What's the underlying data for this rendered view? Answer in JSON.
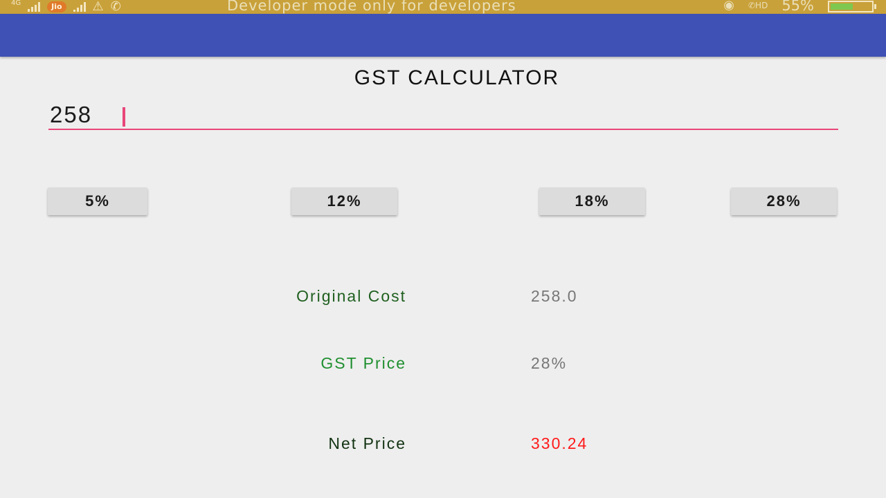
{
  "status_bar": {
    "network": "4G",
    "carrier": "Jio",
    "notice": "Developer mode only for developers",
    "hd": "HD",
    "battery_percent": "55%",
    "battery_level": 0.55
  },
  "app": {
    "title": "GST CALCULATOR",
    "accent_color": "#e8467a",
    "appbar_color": "#3f51b5"
  },
  "input": {
    "value": "258"
  },
  "rates": [
    {
      "label": "5%"
    },
    {
      "label": "12%"
    },
    {
      "label": "18%"
    },
    {
      "label": "28%"
    }
  ],
  "results": {
    "original_cost": {
      "label": "Original Cost",
      "value": "258.0",
      "label_color": "#1f5f1f",
      "value_color": "#777777"
    },
    "gst_price": {
      "label": "GST Price",
      "value": "28%",
      "label_color": "#1f8f2f",
      "value_color": "#777777"
    },
    "net_price": {
      "label": "Net Price",
      "value": "330.24",
      "label_color": "#123312",
      "value_color": "#ff1a1a"
    }
  }
}
